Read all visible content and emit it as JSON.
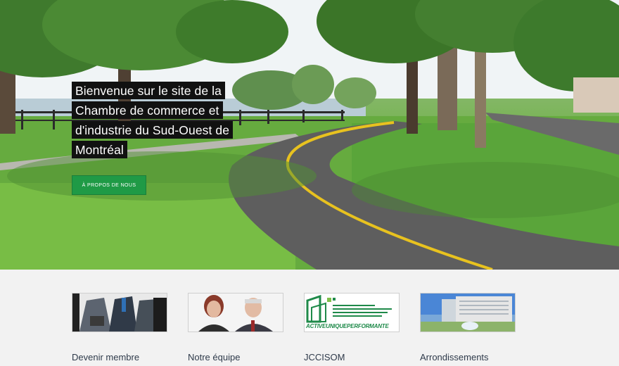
{
  "hero": {
    "headline_lines": [
      "Bienvenue sur le site de la",
      "Chambre de commerce et",
      "d'industrie du Sud-Ouest de",
      "Montréal"
    ],
    "about_button_label": "À PROPOS DE NOUS"
  },
  "cards": [
    {
      "label": "Devenir membre"
    },
    {
      "label": "Notre équipe"
    },
    {
      "label": "JCCISOM",
      "logo_tagline": "ACTIVEUNIQUEPERFORMANTE"
    },
    {
      "label": "Arrondissements"
    }
  ],
  "colors": {
    "accent_green": "#1f9a46",
    "headline_bg": "#111111",
    "page_bg": "#f2f2f2"
  }
}
